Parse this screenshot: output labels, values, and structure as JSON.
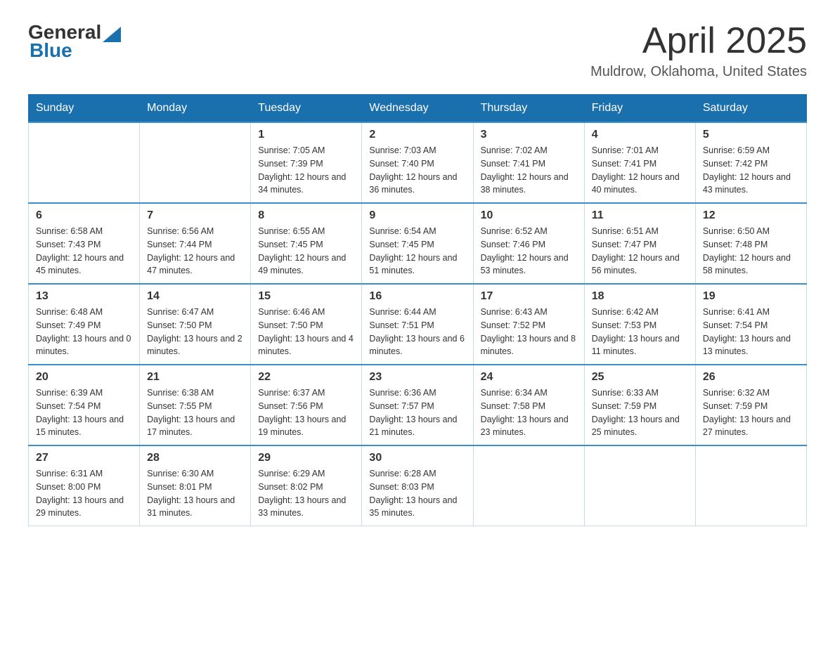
{
  "header": {
    "logo_general": "General",
    "logo_blue": "Blue",
    "month_title": "April 2025",
    "location": "Muldrow, Oklahoma, United States"
  },
  "days_of_week": [
    "Sunday",
    "Monday",
    "Tuesday",
    "Wednesday",
    "Thursday",
    "Friday",
    "Saturday"
  ],
  "weeks": [
    [
      {
        "day": "",
        "sunrise": "",
        "sunset": "",
        "daylight": ""
      },
      {
        "day": "",
        "sunrise": "",
        "sunset": "",
        "daylight": ""
      },
      {
        "day": "1",
        "sunrise": "Sunrise: 7:05 AM",
        "sunset": "Sunset: 7:39 PM",
        "daylight": "Daylight: 12 hours and 34 minutes."
      },
      {
        "day": "2",
        "sunrise": "Sunrise: 7:03 AM",
        "sunset": "Sunset: 7:40 PM",
        "daylight": "Daylight: 12 hours and 36 minutes."
      },
      {
        "day": "3",
        "sunrise": "Sunrise: 7:02 AM",
        "sunset": "Sunset: 7:41 PM",
        "daylight": "Daylight: 12 hours and 38 minutes."
      },
      {
        "day": "4",
        "sunrise": "Sunrise: 7:01 AM",
        "sunset": "Sunset: 7:41 PM",
        "daylight": "Daylight: 12 hours and 40 minutes."
      },
      {
        "day": "5",
        "sunrise": "Sunrise: 6:59 AM",
        "sunset": "Sunset: 7:42 PM",
        "daylight": "Daylight: 12 hours and 43 minutes."
      }
    ],
    [
      {
        "day": "6",
        "sunrise": "Sunrise: 6:58 AM",
        "sunset": "Sunset: 7:43 PM",
        "daylight": "Daylight: 12 hours and 45 minutes."
      },
      {
        "day": "7",
        "sunrise": "Sunrise: 6:56 AM",
        "sunset": "Sunset: 7:44 PM",
        "daylight": "Daylight: 12 hours and 47 minutes."
      },
      {
        "day": "8",
        "sunrise": "Sunrise: 6:55 AM",
        "sunset": "Sunset: 7:45 PM",
        "daylight": "Daylight: 12 hours and 49 minutes."
      },
      {
        "day": "9",
        "sunrise": "Sunrise: 6:54 AM",
        "sunset": "Sunset: 7:45 PM",
        "daylight": "Daylight: 12 hours and 51 minutes."
      },
      {
        "day": "10",
        "sunrise": "Sunrise: 6:52 AM",
        "sunset": "Sunset: 7:46 PM",
        "daylight": "Daylight: 12 hours and 53 minutes."
      },
      {
        "day": "11",
        "sunrise": "Sunrise: 6:51 AM",
        "sunset": "Sunset: 7:47 PM",
        "daylight": "Daylight: 12 hours and 56 minutes."
      },
      {
        "day": "12",
        "sunrise": "Sunrise: 6:50 AM",
        "sunset": "Sunset: 7:48 PM",
        "daylight": "Daylight: 12 hours and 58 minutes."
      }
    ],
    [
      {
        "day": "13",
        "sunrise": "Sunrise: 6:48 AM",
        "sunset": "Sunset: 7:49 PM",
        "daylight": "Daylight: 13 hours and 0 minutes."
      },
      {
        "day": "14",
        "sunrise": "Sunrise: 6:47 AM",
        "sunset": "Sunset: 7:50 PM",
        "daylight": "Daylight: 13 hours and 2 minutes."
      },
      {
        "day": "15",
        "sunrise": "Sunrise: 6:46 AM",
        "sunset": "Sunset: 7:50 PM",
        "daylight": "Daylight: 13 hours and 4 minutes."
      },
      {
        "day": "16",
        "sunrise": "Sunrise: 6:44 AM",
        "sunset": "Sunset: 7:51 PM",
        "daylight": "Daylight: 13 hours and 6 minutes."
      },
      {
        "day": "17",
        "sunrise": "Sunrise: 6:43 AM",
        "sunset": "Sunset: 7:52 PM",
        "daylight": "Daylight: 13 hours and 8 minutes."
      },
      {
        "day": "18",
        "sunrise": "Sunrise: 6:42 AM",
        "sunset": "Sunset: 7:53 PM",
        "daylight": "Daylight: 13 hours and 11 minutes."
      },
      {
        "day": "19",
        "sunrise": "Sunrise: 6:41 AM",
        "sunset": "Sunset: 7:54 PM",
        "daylight": "Daylight: 13 hours and 13 minutes."
      }
    ],
    [
      {
        "day": "20",
        "sunrise": "Sunrise: 6:39 AM",
        "sunset": "Sunset: 7:54 PM",
        "daylight": "Daylight: 13 hours and 15 minutes."
      },
      {
        "day": "21",
        "sunrise": "Sunrise: 6:38 AM",
        "sunset": "Sunset: 7:55 PM",
        "daylight": "Daylight: 13 hours and 17 minutes."
      },
      {
        "day": "22",
        "sunrise": "Sunrise: 6:37 AM",
        "sunset": "Sunset: 7:56 PM",
        "daylight": "Daylight: 13 hours and 19 minutes."
      },
      {
        "day": "23",
        "sunrise": "Sunrise: 6:36 AM",
        "sunset": "Sunset: 7:57 PM",
        "daylight": "Daylight: 13 hours and 21 minutes."
      },
      {
        "day": "24",
        "sunrise": "Sunrise: 6:34 AM",
        "sunset": "Sunset: 7:58 PM",
        "daylight": "Daylight: 13 hours and 23 minutes."
      },
      {
        "day": "25",
        "sunrise": "Sunrise: 6:33 AM",
        "sunset": "Sunset: 7:59 PM",
        "daylight": "Daylight: 13 hours and 25 minutes."
      },
      {
        "day": "26",
        "sunrise": "Sunrise: 6:32 AM",
        "sunset": "Sunset: 7:59 PM",
        "daylight": "Daylight: 13 hours and 27 minutes."
      }
    ],
    [
      {
        "day": "27",
        "sunrise": "Sunrise: 6:31 AM",
        "sunset": "Sunset: 8:00 PM",
        "daylight": "Daylight: 13 hours and 29 minutes."
      },
      {
        "day": "28",
        "sunrise": "Sunrise: 6:30 AM",
        "sunset": "Sunset: 8:01 PM",
        "daylight": "Daylight: 13 hours and 31 minutes."
      },
      {
        "day": "29",
        "sunrise": "Sunrise: 6:29 AM",
        "sunset": "Sunset: 8:02 PM",
        "daylight": "Daylight: 13 hours and 33 minutes."
      },
      {
        "day": "30",
        "sunrise": "Sunrise: 6:28 AM",
        "sunset": "Sunset: 8:03 PM",
        "daylight": "Daylight: 13 hours and 35 minutes."
      },
      {
        "day": "",
        "sunrise": "",
        "sunset": "",
        "daylight": ""
      },
      {
        "day": "",
        "sunrise": "",
        "sunset": "",
        "daylight": ""
      },
      {
        "day": "",
        "sunrise": "",
        "sunset": "",
        "daylight": ""
      }
    ]
  ]
}
